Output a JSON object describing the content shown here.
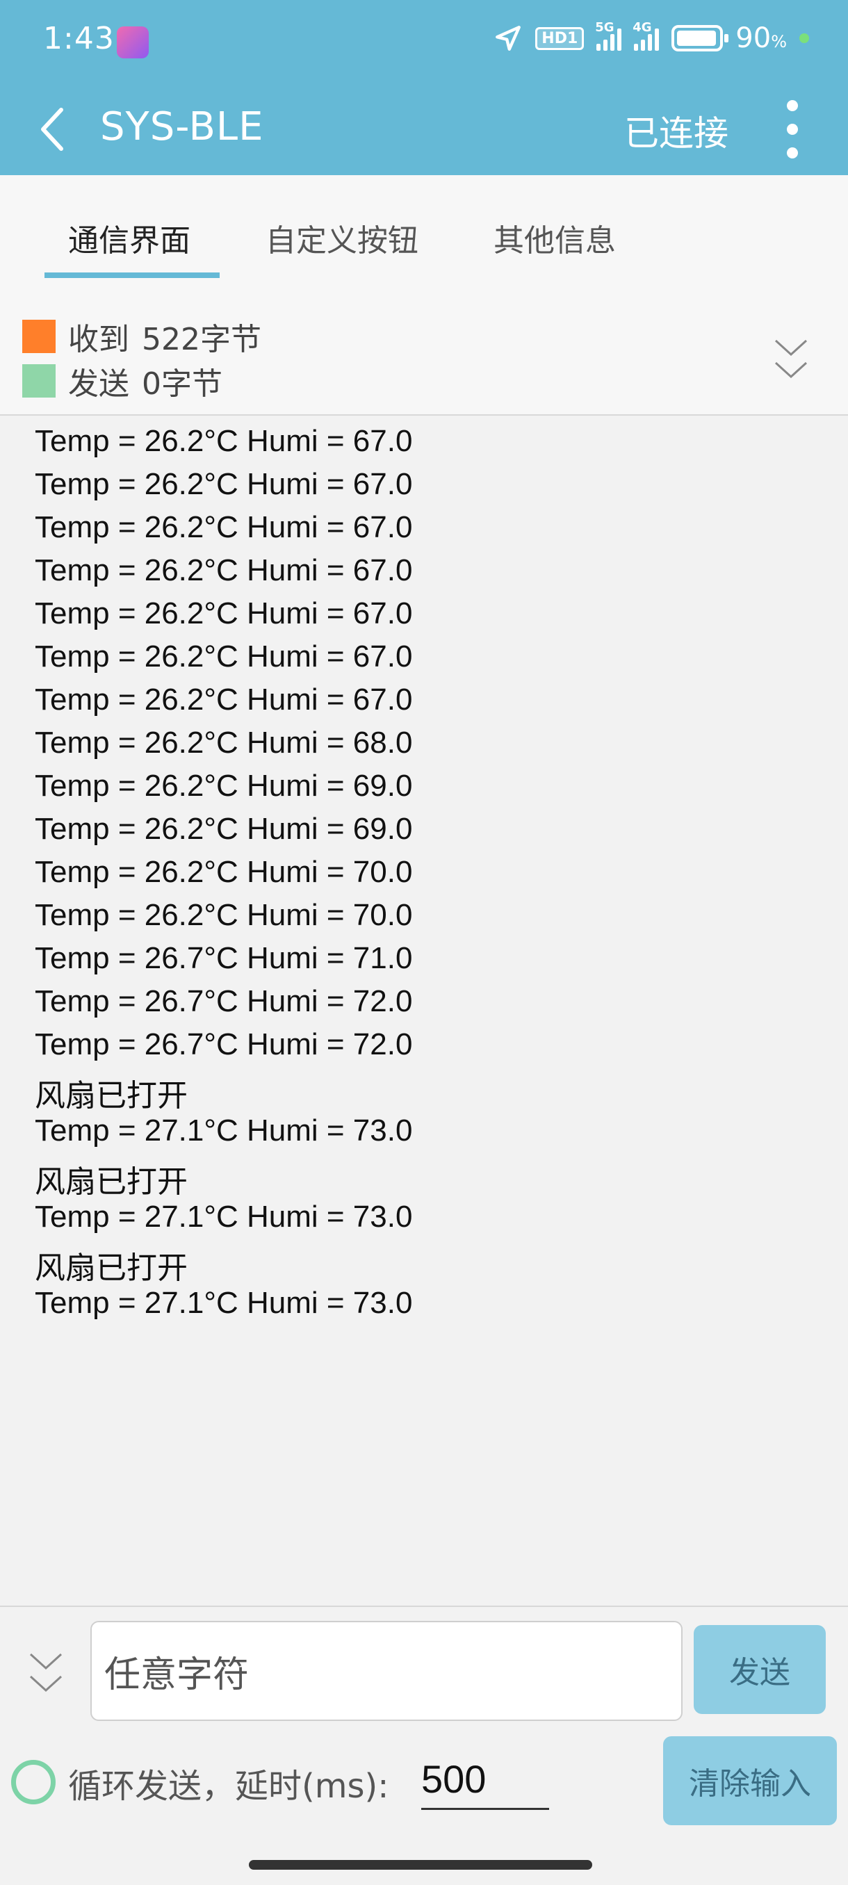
{
  "status_bar": {
    "time": "1:43",
    "hd_label": "HD1",
    "sim1_label": "5G",
    "sim2_label": "4G",
    "battery_percent": "90",
    "battery_unit": "%"
  },
  "app_bar": {
    "title": "SYS-BLE",
    "connection_status": "已连接"
  },
  "tabs": [
    {
      "label": "通信界面",
      "active": true
    },
    {
      "label": "自定义按钮",
      "active": false
    },
    {
      "label": "其他信息",
      "active": false
    }
  ],
  "counters": {
    "received_label": "收到",
    "received_value": "522字节",
    "received_color": "#ff7f2a",
    "sent_label": "发送",
    "sent_value": "0字节",
    "sent_color": "#8fd6a8"
  },
  "log": [
    "Temp = 26.2°C Humi = 67.0",
    "Temp = 26.2°C Humi = 67.0",
    "Temp = 26.2°C Humi = 67.0",
    "Temp = 26.2°C Humi = 67.0",
    "Temp = 26.2°C Humi = 67.0",
    "Temp = 26.2°C Humi = 67.0",
    "Temp = 26.2°C Humi = 67.0",
    "Temp = 26.2°C Humi = 68.0",
    "Temp = 26.2°C Humi = 69.0",
    "Temp = 26.2°C Humi = 69.0",
    "Temp = 26.2°C Humi = 70.0",
    "Temp = 26.2°C Humi = 70.0",
    "Temp = 26.7°C Humi = 71.0",
    "Temp = 26.7°C Humi = 72.0",
    "Temp = 26.7°C Humi = 72.0",
    "风扇已打开",
    "Temp = 27.1°C Humi = 73.0",
    "风扇已打开",
    "Temp = 27.1°C Humi = 73.0",
    "风扇已打开",
    "Temp = 27.1°C Humi = 73.0"
  ],
  "composer": {
    "input_placeholder": "任意字符",
    "send_label": "发送",
    "loop_label": "循环发送，延时(ms):",
    "delay_value": "500",
    "clear_label": "清除输入"
  },
  "colors": {
    "accent": "#65b9d6",
    "button": "#8ecde3",
    "loop_radio": "#7dd3a7"
  },
  "icons": {
    "back": "back-arrow-icon",
    "more": "more-vertical-icon",
    "collapse": "double-chevron-down-icon",
    "expand": "double-chevron-down-icon"
  }
}
